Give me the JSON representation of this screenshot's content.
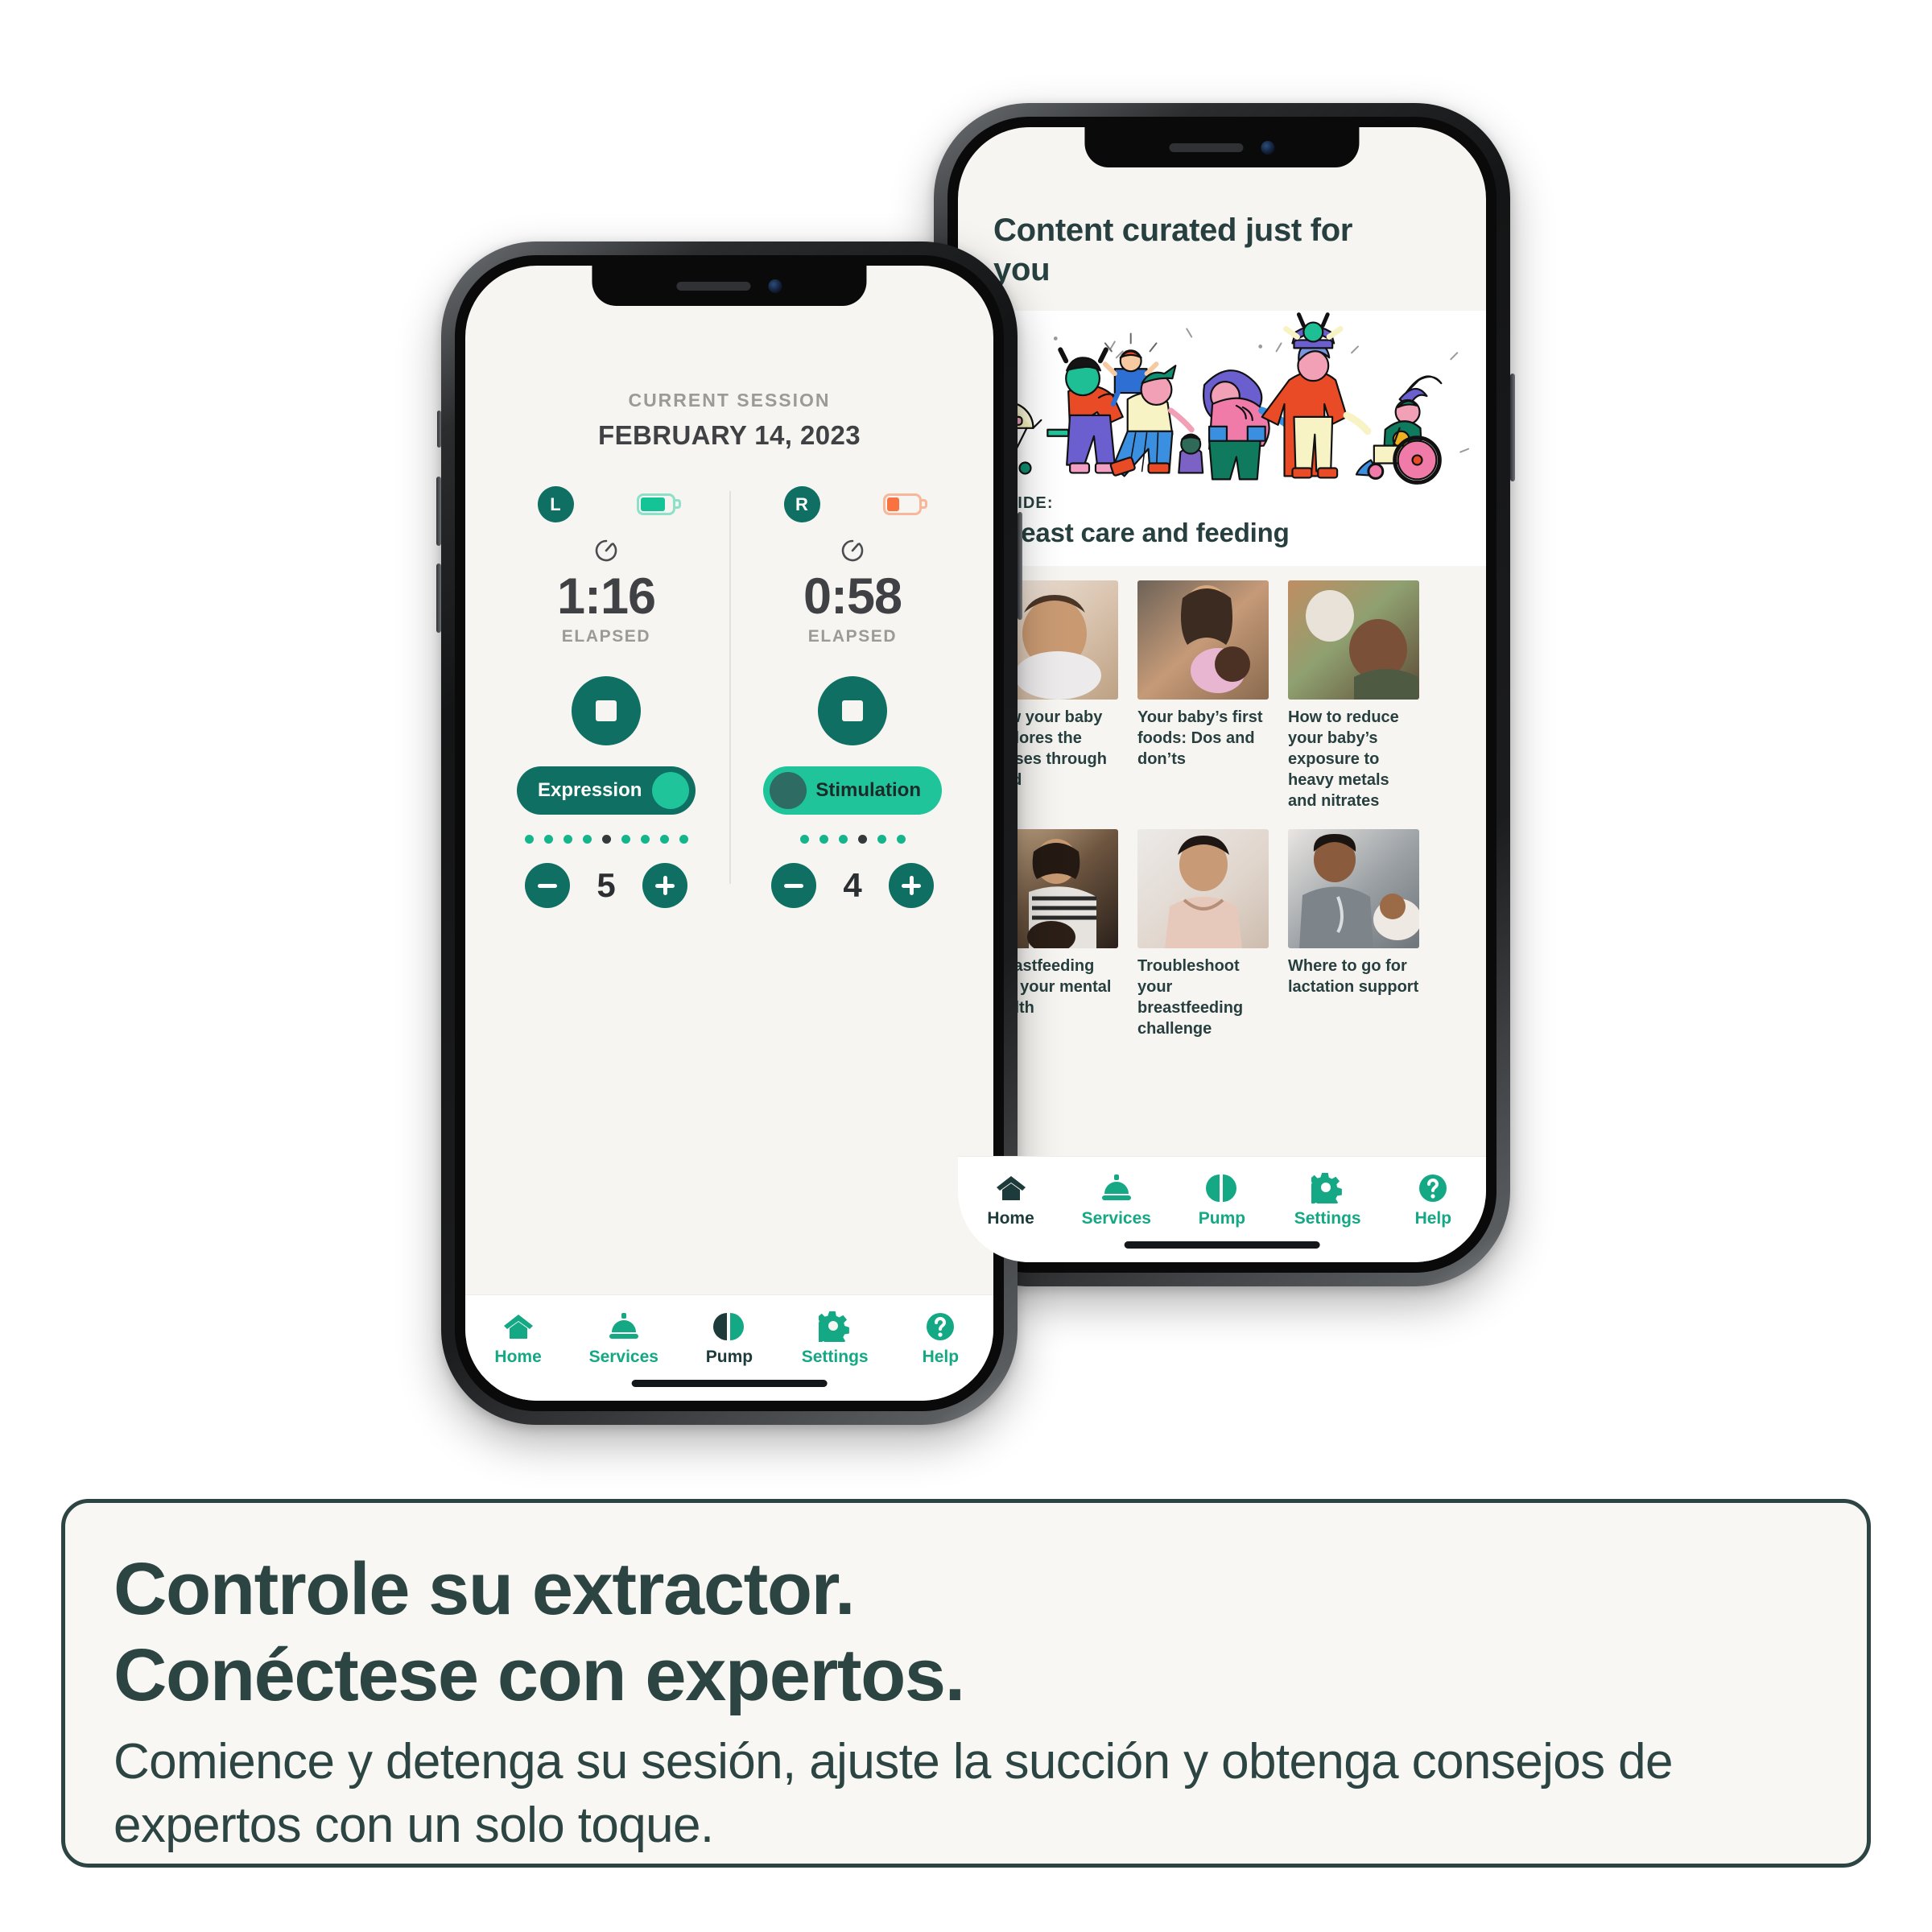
{
  "phone_pump": {
    "session_label": "CURRENT SESSION",
    "session_date": "FEBRUARY 14, 2023",
    "sides": [
      {
        "badge": "L",
        "battery_icon": "battery-full-icon",
        "battery_level_pct": 88,
        "battery_color": "#15c496",
        "timer_icon": "stopwatch-icon",
        "elapsed": "1:16",
        "elapsed_label": "ELAPSED",
        "stop_icon": "stop-square-icon",
        "mode": "Expression",
        "mode_state": "on",
        "dots_total": 9,
        "dots_active_index": 5,
        "decrement_icon": "minus-icon",
        "increment_icon": "plus-icon",
        "level": "5"
      },
      {
        "badge": "R",
        "battery_icon": "battery-low-icon",
        "battery_level_pct": 40,
        "battery_color": "#f97240",
        "timer_icon": "stopwatch-icon",
        "elapsed": "0:58",
        "elapsed_label": "ELAPSED",
        "stop_icon": "stop-square-icon",
        "mode": "Stimulation",
        "mode_state": "off",
        "dots_total": 6,
        "dots_active_index": 4,
        "decrement_icon": "minus-icon",
        "increment_icon": "plus-icon",
        "level": "4"
      }
    ],
    "tabs": [
      {
        "label": "Home",
        "icon": "home-icon",
        "active": false
      },
      {
        "label": "Services",
        "icon": "bell-icon",
        "active": false
      },
      {
        "label": "Pump",
        "icon": "pump-icon",
        "active": true
      },
      {
        "label": "Settings",
        "icon": "gear-icon",
        "active": false
      },
      {
        "label": "Help",
        "icon": "question-icon",
        "active": false
      }
    ]
  },
  "phone_content": {
    "title": "Content curated just for you",
    "guide": {
      "kicker": "GUIDE:",
      "title": "Breast care and feeding",
      "illustration": "diverse-families-illustration"
    },
    "cards": [
      {
        "title": "How your baby explores the senses through food",
        "thumb": "baby-eating-photo"
      },
      {
        "title": "Your baby’s first foods: Dos and don’ts",
        "thumb": "mother-nursing-photo"
      },
      {
        "title": "How to reduce your baby’s exposure to heavy metals and nitrates",
        "thumb": "parent-holding-baby-photo"
      },
      {
        "title": "Breastfeeding and your mental health",
        "thumb": "mother-with-baby-indoors-photo"
      },
      {
        "title": "Troubleshoot your breastfeeding challenge",
        "thumb": "woman-checking-breast-photo"
      },
      {
        "title": "Where to go for lactation support",
        "thumb": "nurse-with-baby-photo"
      }
    ],
    "tabs": [
      {
        "label": "Home",
        "icon": "home-icon",
        "active": true
      },
      {
        "label": "Services",
        "icon": "bell-icon",
        "active": false
      },
      {
        "label": "Pump",
        "icon": "pump-icon",
        "active": false
      },
      {
        "label": "Settings",
        "icon": "gear-icon",
        "active": false
      },
      {
        "label": "Help",
        "icon": "question-icon",
        "active": false
      }
    ]
  },
  "caption": {
    "heading_line1": "Controle su extractor.",
    "heading_line2": "Conéctese con expertos.",
    "body": "Comience y detenga su sesión, ajuste la succión y obtenga consejos de expertos con un solo toque."
  },
  "colors": {
    "brand_green": "#15a884",
    "deep_teal": "#0e6f62",
    "bright_green": "#1fc49a",
    "ink": "#2c4543",
    "screen_bg": "#f7f5f1",
    "battery_ok": "#15c496",
    "battery_low": "#f97240"
  }
}
